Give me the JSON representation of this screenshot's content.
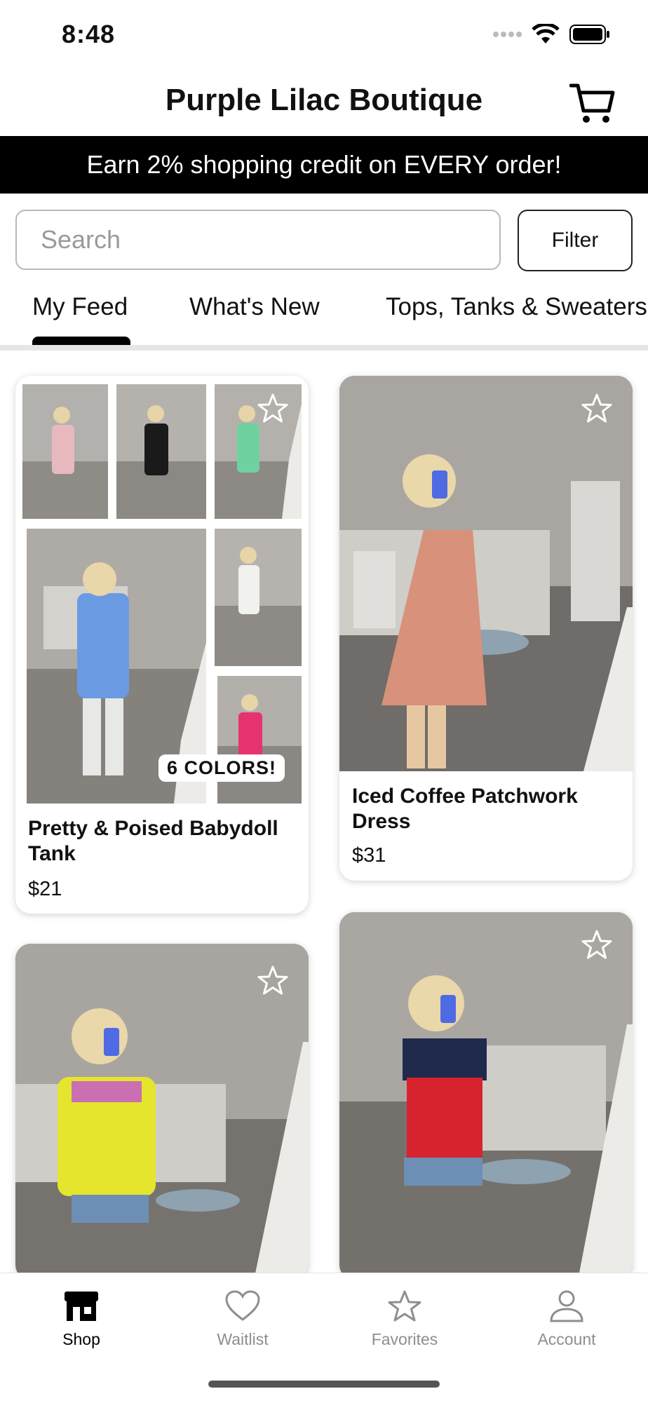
{
  "status_bar": {
    "time": "8:48"
  },
  "header": {
    "title": "Purple Lilac Boutique"
  },
  "promo": {
    "text": "Earn 2% shopping credit on EVERY order!"
  },
  "search": {
    "placeholder": "Search",
    "value": ""
  },
  "filter": {
    "label": "Filter"
  },
  "tabs": [
    {
      "label": "My Feed",
      "active": true
    },
    {
      "label": "What's New",
      "active": false
    },
    {
      "label": "Tops, Tanks & Sweaters",
      "active": false
    }
  ],
  "products": [
    {
      "name": "Pretty & Poised Babydoll Tank",
      "price": "$21",
      "badge": "6 COLORS!"
    },
    {
      "name": "Iced Coffee Patchwork Dress",
      "price": "$31"
    },
    {
      "name": "",
      "price": ""
    },
    {
      "name": "",
      "price": ""
    }
  ],
  "tabbar": {
    "items": [
      {
        "label": "Shop",
        "icon": "storefront-icon",
        "active": true
      },
      {
        "label": "Waitlist",
        "icon": "heart-icon",
        "active": false
      },
      {
        "label": "Favorites",
        "icon": "star-icon",
        "active": false
      },
      {
        "label": "Account",
        "icon": "person-icon",
        "active": false
      }
    ]
  },
  "colors": {
    "accent": "#000000",
    "inactive": "#8e8e8e",
    "promo_bg": "#000000"
  }
}
